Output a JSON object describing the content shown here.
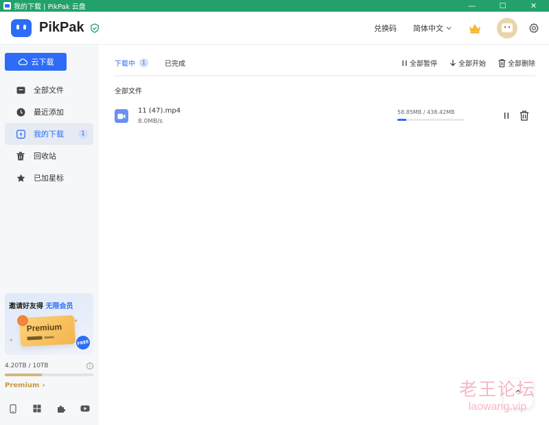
{
  "window": {
    "title": "我的下载 | PikPak 云盘",
    "controls": {
      "minimize": "—",
      "maximize": "☐",
      "close": "✕"
    }
  },
  "header": {
    "brand": "PikPak",
    "redeem_label": "兑换码",
    "language_label": "简体中文",
    "icons": [
      "shield-check-icon",
      "crown-icon",
      "avatar",
      "gear-icon"
    ]
  },
  "sidebar": {
    "cloud_download_label": "云下载",
    "items": [
      {
        "label": "全部文件",
        "icon": "folder-icon"
      },
      {
        "label": "最近添加",
        "icon": "clock-icon"
      },
      {
        "label": "我的下载",
        "icon": "download-icon",
        "badge": "1",
        "active": true
      },
      {
        "label": "回收站",
        "icon": "trash-icon"
      },
      {
        "label": "已加星标",
        "icon": "star-icon"
      }
    ],
    "promo": {
      "title": "邀请好友得",
      "highlight": "无限会员",
      "card_text": "Premium",
      "free_tag": "FREE"
    },
    "storage": {
      "text": "4.20TB / 10TB",
      "used_fraction": 0.42,
      "info_icon": "i"
    },
    "premium_link": "Premium",
    "premium_chevron": "›",
    "apps": [
      "phone-icon",
      "windows-icon",
      "extension-icon",
      "youtube-icon"
    ]
  },
  "main": {
    "tabs": [
      {
        "label": "下载中",
        "badge": "1",
        "active": true
      },
      {
        "label": "已完成"
      }
    ],
    "actions": {
      "pause_all": "全部暂停",
      "start_all": "全部开始",
      "delete_all": "全部删除"
    },
    "section_title": "全部文件",
    "files": [
      {
        "name": "11 (47).mp4",
        "speed": "8.0MB/s",
        "progress_text": "58.85MB / 438.42MB",
        "progress_fraction": 0.134
      }
    ],
    "scroll_top_label": "^"
  },
  "watermark": {
    "cn": "老王论坛",
    "en": "laowang.vip"
  },
  "colors": {
    "titlebar": "#22a16b",
    "accent": "#2d6cf6",
    "premium_gold": "#c9973d",
    "sidebar_bg": "#f6f7f9"
  }
}
